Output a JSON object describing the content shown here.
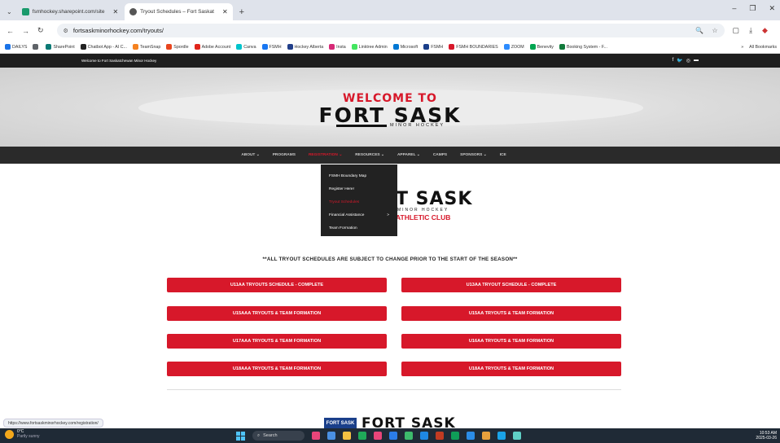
{
  "browser": {
    "tabs": [
      {
        "label": "fsmhockey.sharepoint.com/site",
        "color": "#1a9a6c",
        "active": false
      },
      {
        "label": "Tryout Schedules – Fort Saskat",
        "color": "#555555",
        "active": true
      }
    ],
    "new_tab": "+",
    "url": "fortsaskminorhockey.com/tryouts/",
    "bookmarks": [
      {
        "label": "DAILYS",
        "color": "#1a73e8"
      },
      {
        "label": "",
        "color": "#5f6368"
      },
      {
        "label": "SharePoint",
        "color": "#0b7a75"
      },
      {
        "label": "Chatbot App - AI C...",
        "color": "#222222"
      },
      {
        "label": "TeamSnap",
        "color": "#f58220"
      },
      {
        "label": "Spordle",
        "color": "#e8451e"
      },
      {
        "label": "Adobe Account",
        "color": "#e1251b"
      },
      {
        "label": "Canva",
        "color": "#00c4cc"
      },
      {
        "label": "FSMH",
        "color": "#1877f2"
      },
      {
        "label": "Hockey Alberta",
        "color": "#223f8a"
      },
      {
        "label": "Insta",
        "color": "#d62976"
      },
      {
        "label": "Linktree Admin",
        "color": "#43e660"
      },
      {
        "label": "Microsoft",
        "color": "#0078d4"
      },
      {
        "label": "FSMH",
        "color": "#1a3f8a"
      },
      {
        "label": "FSMH BOUNDARIES",
        "color": "#d7182a"
      },
      {
        "label": "ZOOM",
        "color": "#2d8cff"
      },
      {
        "label": "Benevity",
        "color": "#00a651"
      },
      {
        "label": "Booking System - F...",
        "color": "#117a3b"
      }
    ],
    "bookmarks_more": "»",
    "all_bookmarks": "All Bookmarks",
    "status_url": "https://www.fortsaskminorhockey.com/registration/"
  },
  "site": {
    "top_strip_text": "Welcome to Fort Saskatchewan Minor Hockey",
    "social_icons": [
      "f",
      "t",
      "ig",
      "yt"
    ],
    "hero": {
      "welcome": "WELCOME TO",
      "brand": "FORT SASK",
      "sub": "MINOR HOCKEY"
    },
    "nav": [
      {
        "label": "ABOUT ⌄",
        "active": false
      },
      {
        "label": "PROGRAMS",
        "active": false
      },
      {
        "label": "REGISTRATION ⌄",
        "active": true
      },
      {
        "label": "RESOURCES ⌄",
        "active": false
      },
      {
        "label": "APPAREL ⌄",
        "active": false
      },
      {
        "label": "CAMPS",
        "active": false
      },
      {
        "label": "SPONSORS ⌄",
        "active": false
      },
      {
        "label": "ICE",
        "active": false
      }
    ],
    "dropdown": [
      {
        "label": "FSMH Boundary Map",
        "active": false,
        "arrow": ""
      },
      {
        "label": "Register Here!",
        "active": false,
        "arrow": ""
      },
      {
        "label": "Tryout Schedules",
        "active": true,
        "arrow": ""
      },
      {
        "label": "Financial Assistance",
        "active": false,
        "arrow": ">"
      },
      {
        "label": "Team Formation",
        "active": false,
        "arrow": ""
      }
    ],
    "logo2": {
      "big": "T SASK",
      "mh": "MINOR HOCKEY",
      "ac": "ATHLETIC CLUB"
    },
    "notice": "**ALL TRYOUT SCHEDULES ARE SUBJECT TO CHANGE PRIOR TO THE START OF THE SEASON**",
    "buttons": [
      "U11AA TRYOUTS SCHEDULE - COMPLETE",
      "U13AA TRYOUT SCHEDULE - COMPLETE",
      "U15AAA TRYOUTS & TEAM FORMATION",
      "U15AA TRYOUTS & TEAM FORMATION",
      "U17AAA TRYOUTS & TEAM FORMATION",
      "U16AA TRYOUTS & TEAM FORMATION",
      "U18AAA TRYOUTS & TEAM FORMATION",
      "U18AA TRYOUTS & TEAM FORMATION"
    ],
    "footer": {
      "badge": "FORT SASK",
      "text": "FORT SASK"
    },
    "accent": "#d7182a"
  },
  "taskbar": {
    "weather_temp": "0°C",
    "weather_desc": "Partly sunny",
    "search": "Search",
    "time": "10:53 AM",
    "date": "2025-03-26",
    "app_colors": [
      "#e8457a",
      "#4a90e2",
      "#f5c242",
      "#1faa59",
      "#e8457a",
      "#2b7de9",
      "#3dbb6c",
      "#1e88e5",
      "#c23b22",
      "#0f9d58",
      "#2b8de8",
      "#e8a13d",
      "#1aa3e8",
      "#5fd0c6"
    ]
  }
}
